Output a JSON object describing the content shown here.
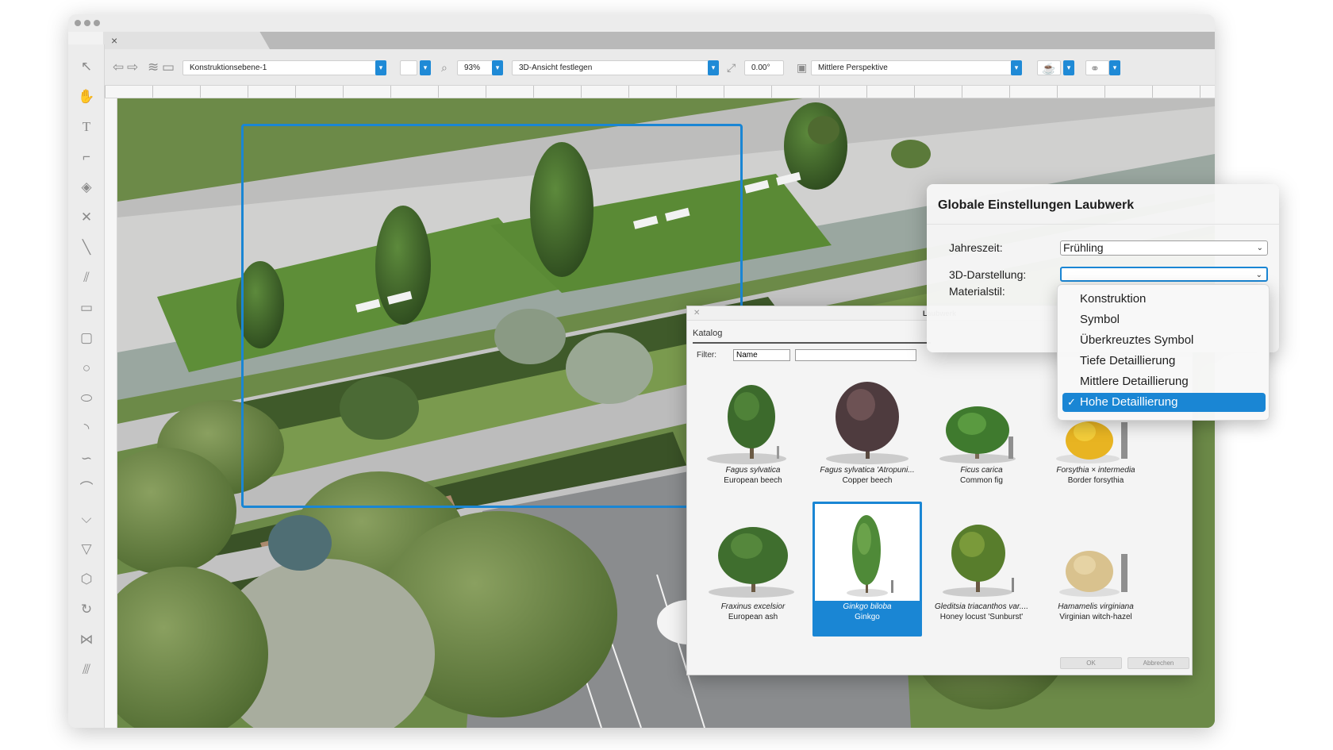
{
  "toolbar": {
    "layer": "Konstruktionsebene-1",
    "zoom": "93%",
    "view3d": "3D-Ansicht festlegen",
    "angle": "0.00°",
    "perspective": "Mittlere Perspektive"
  },
  "tab": {
    "close": "×"
  },
  "laubwerk_dialog": {
    "title": "Laubwerk",
    "close": "✕",
    "tab_katalog": "Katalog",
    "filter_label": "Filter:",
    "filter_select": "Name",
    "filter_value": "",
    "items": [
      {
        "latin": "Fagus sylvatica",
        "common": "European beech"
      },
      {
        "latin": "Fagus sylvatica 'Atropuni...",
        "common": "Copper beech"
      },
      {
        "latin": "Ficus carica",
        "common": "Common fig"
      },
      {
        "latin": "Forsythia × intermedia",
        "common": "Border forsythia"
      },
      {
        "latin": "Fraxinus excelsior",
        "common": "European ash"
      },
      {
        "latin": "Ginkgo biloba",
        "common": "Ginkgo"
      },
      {
        "latin": "Gleditsia triacanthos var....",
        "common": "Honey locust 'Sunburst'"
      },
      {
        "latin": "Hamamelis virginiana",
        "common": "Virginian witch-hazel"
      }
    ],
    "selected_index": 5,
    "ok": "OK",
    "cancel": "Abbrechen"
  },
  "global_dialog": {
    "title": "Globale Einstellungen Laubwerk",
    "season_label": "Jahreszeit:",
    "season_value": "Frühling",
    "display_label": "3D-Darstellung:",
    "display_value": "",
    "material_label": "Materialstil:"
  },
  "dropdown_menu": {
    "items": [
      "Konstruktion",
      "Symbol",
      "Überkreuztes Symbol",
      "Tiefe Detaillierung",
      "Mittlere Detaillierung",
      "Hohe Detaillierung"
    ],
    "checked": "Hohe Detaillierung",
    "check_mark": "✓"
  },
  "colors": {
    "accent": "#1a86d4",
    "grass": "#5f8a3a",
    "path": "#b8b8b8"
  }
}
